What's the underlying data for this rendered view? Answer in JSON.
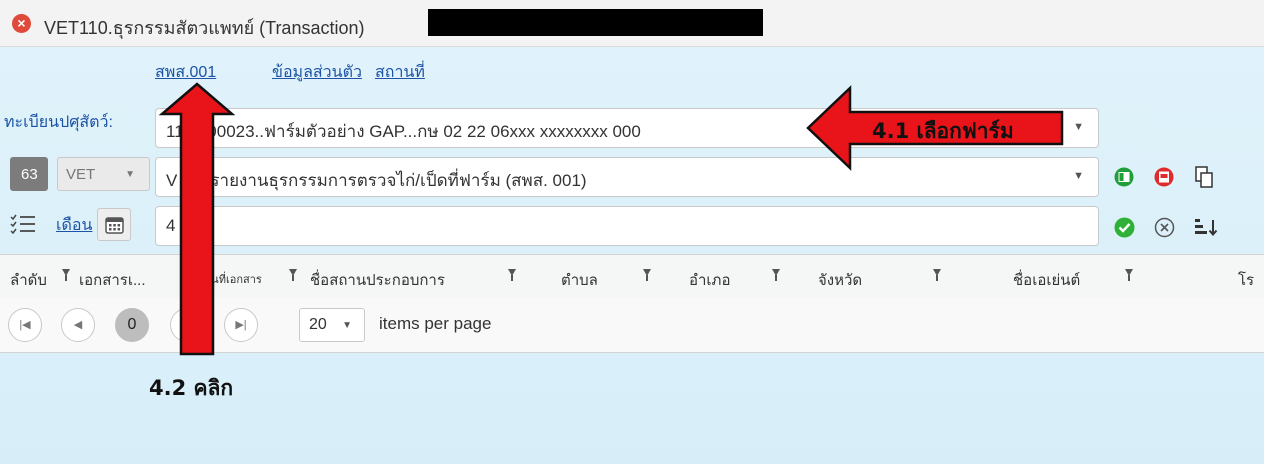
{
  "window": {
    "title": "VET110.ธุรกรรมสัตวแพทย์ (Transaction)"
  },
  "tabs": [
    {
      "label": "สพส.001"
    },
    {
      "label": "ข้อมูลส่วนตัว"
    },
    {
      "label": "สถานที่"
    }
  ],
  "form": {
    "registration_label": "ทะเบียนปศุสัตว์:",
    "registration_value": "11   6300023..ฟาร์มตัวอย่าง GAP...กษ 02 22 06xxx xxxxxxxx 000",
    "year_value": "63",
    "dept_value": "VET",
    "report_value": "V     00..รายงานธุรกรรมการตรวจไก่/เป็ดที่ฟาร์ม (สพส. 001)",
    "month_link": "เดือน",
    "month_value": "4    63"
  },
  "grid": {
    "columns": [
      "ลำดับ",
      "เอกสารเ...",
      "วันที่เอกสาร",
      "ชื่อสถานประกอบการ",
      "ตำบล",
      "อำเภอ",
      "จังหวัด",
      "ชื่อเอเย่นต์",
      "โร"
    ]
  },
  "pager": {
    "page_number": "0",
    "page_size": "20",
    "items_per_page_label": "items per page"
  },
  "annotations": {
    "select_farm": "4.1 เลือกฟาร์ม",
    "click": "4.2 คลิก",
    "arrow_color": "#e8141a"
  },
  "icons": [
    "close-icon",
    "calendar-icon",
    "checklist-icon",
    "excel-icon",
    "pdf-icon",
    "copy-icon",
    "confirm-icon",
    "clear-icon",
    "sort-icon",
    "filter-icon"
  ]
}
